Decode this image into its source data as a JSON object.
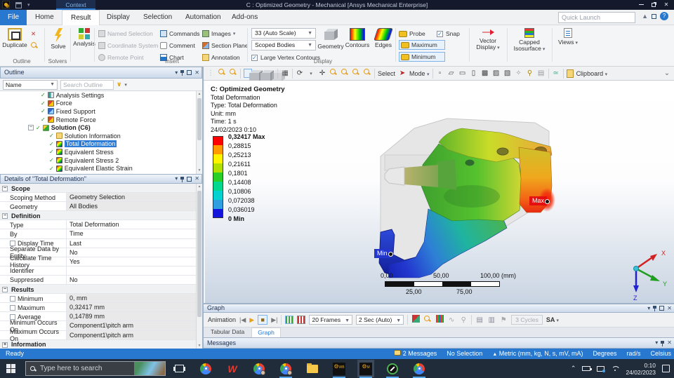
{
  "colors": {
    "titlebar": "#141a2b",
    "accent_blue": "#2878cf",
    "selection_blue": "#2e7cd6",
    "max_red": "#e41010",
    "min_blue": "#2337cf",
    "taskbar": "#212c3a"
  },
  "icons": {
    "check": "✓",
    "close": "✕",
    "caret": "▾",
    "up": "▲",
    "down": "▼",
    "first": "|◀",
    "last": "▶|",
    "play": "▶",
    "stop": "■",
    "plus": "+",
    "minus": "−",
    "filter": "∨",
    "red_x": "✕",
    "pan": "✛",
    "rotate": "⟳",
    "chevdown": "⌄",
    "question": "?"
  },
  "titlebar": {
    "context_tab": "Context",
    "title": "C : Optimized Geometry - Mechanical [Ansys Mechanical Enterprise]"
  },
  "tabrow": {
    "file": "File",
    "tabs": [
      "Home",
      "Result",
      "Display",
      "Selection",
      "Automation",
      "Add-ons"
    ],
    "active_tab": "Result",
    "quick_launch_placeholder": "Quick Launch"
  },
  "ribbon": {
    "duplicate": "Duplicate",
    "outline_label": "Outline",
    "solve": "Solve",
    "solvers_label": "Solvers",
    "analysis": "Analysis",
    "insert": {
      "named_selection": "Named Selection",
      "coordinate_system": "Coordinate System",
      "remote_point": "Remote Point",
      "commands": "Commands",
      "comment": "Comment",
      "chart": "Chart",
      "images": "Images",
      "section_plane": "Section Plane",
      "annotation": "Annotation",
      "label": "Insert"
    },
    "display": {
      "scale": "33 (Auto Scale)",
      "scoped_bodies": "Scoped Bodies",
      "large_vertex": "Large Vertex Contours",
      "geometry": "Geometry",
      "contours": "Contours",
      "edges": "Edges",
      "label": "Display"
    },
    "probe": "Probe",
    "snap": "Snap",
    "maximum": "Maximum",
    "minimum": "Minimum",
    "vector_display": "Vector Display",
    "capped_isosurface": "Capped Isosurface",
    "views": "Views"
  },
  "gfxbar": {
    "select": "Select",
    "mode": "Mode",
    "clipboard": "Clipboard"
  },
  "outline": {
    "header": "Outline",
    "name_filter": "Name",
    "search_placeholder": "Search Outline",
    "tree": [
      {
        "label": "Analysis Settings"
      },
      {
        "label": "Force"
      },
      {
        "label": "Fixed Support"
      },
      {
        "label": "Remote Force"
      },
      {
        "label": "Solution (C6)"
      },
      {
        "label": "Solution Information"
      },
      {
        "label": "Total Deformation"
      },
      {
        "label": "Equivalent Stress"
      },
      {
        "label": "Equivalent Stress 2"
      },
      {
        "label": "Equivalent Elastic Strain"
      }
    ]
  },
  "details": {
    "header": "Details of \"Total Deformation\"",
    "rows": [
      {
        "t": "sec",
        "label": "Scope"
      },
      {
        "t": "row",
        "label": "Scoping Method",
        "value": "Geometry Selection"
      },
      {
        "t": "row",
        "label": "Geometry",
        "value": "All Bodies"
      },
      {
        "t": "sec",
        "label": "Definition"
      },
      {
        "t": "row",
        "label": "Type",
        "value": "Total Deformation"
      },
      {
        "t": "row",
        "label": "By",
        "value": "Time"
      },
      {
        "t": "row",
        "label": "Display Time",
        "value": "Last"
      },
      {
        "t": "row",
        "label": "Separate Data by Entity",
        "value": "No"
      },
      {
        "t": "row",
        "label": "Calculate Time History",
        "value": "Yes"
      },
      {
        "t": "row",
        "label": "Identifier",
        "value": ""
      },
      {
        "t": "row",
        "label": "Suppressed",
        "value": "No"
      },
      {
        "t": "sec",
        "label": "Results"
      },
      {
        "t": "row",
        "label": "Minimum",
        "value": "0, mm"
      },
      {
        "t": "row",
        "label": "Maximum",
        "value": "0,32417 mm"
      },
      {
        "t": "row",
        "label": "Average",
        "value": "0,14789 mm"
      },
      {
        "t": "row",
        "label": "Minimum Occurs On",
        "value": "Component1\\pitch arm"
      },
      {
        "t": "row",
        "label": "Maximum Occurs On",
        "value": "Component1\\pitch arm"
      },
      {
        "t": "sec",
        "label": "Information"
      }
    ]
  },
  "viewport": {
    "annotation": {
      "title": "C: Optimized Geometry",
      "line1": "Total Deformation",
      "line2": "Type: Total Deformation",
      "line3": "Unit: mm",
      "line4": "Time: 1 s",
      "line5": "24/02/2023 0:10"
    },
    "legend": {
      "labels": [
        "0,32417 Max",
        "0,28815",
        "0,25213",
        "0,21611",
        "0,1801",
        "0,14408",
        "0,10806",
        "0,072038",
        "0,036019",
        "0 Min"
      ],
      "colors": [
        "#ff0000",
        "#ff9b00",
        "#fff300",
        "#b1e000",
        "#28cf28",
        "#00d88f",
        "#00d2d2",
        "#2f9fdf",
        "#1414dd"
      ]
    },
    "max_tag": "Max",
    "min_tag": "Min",
    "ruler": {
      "t0": "0,00",
      "t50": "50,00",
      "t100": "100,00 (mm)",
      "b25": "25,00",
      "b75": "75,00"
    },
    "triad": {
      "x": "X",
      "y": "Y",
      "z": "Z"
    }
  },
  "graph": {
    "header": "Graph",
    "animation_label": "Animation",
    "frames": "20 Frames",
    "duration": "2 Sec (Auto)",
    "cycles": "3 Cycles",
    "sa": "SA",
    "tab_tabular": "Tabular Data",
    "tab_graph": "Graph"
  },
  "messages": {
    "header": "Messages"
  },
  "statusbar": {
    "ready": "Ready",
    "messages": "2 Messages",
    "selection": "No Selection",
    "units": "Metric (mm, kg, N, s, mV, mA)",
    "angle": "Degrees",
    "angular": "rad/s",
    "temperature": "Celsius"
  },
  "taskbar": {
    "search_placeholder": "Type here to search",
    "time": "0:10",
    "date": "24/02/2023",
    "wb": "WB",
    "m": "M",
    "wps": "W"
  }
}
